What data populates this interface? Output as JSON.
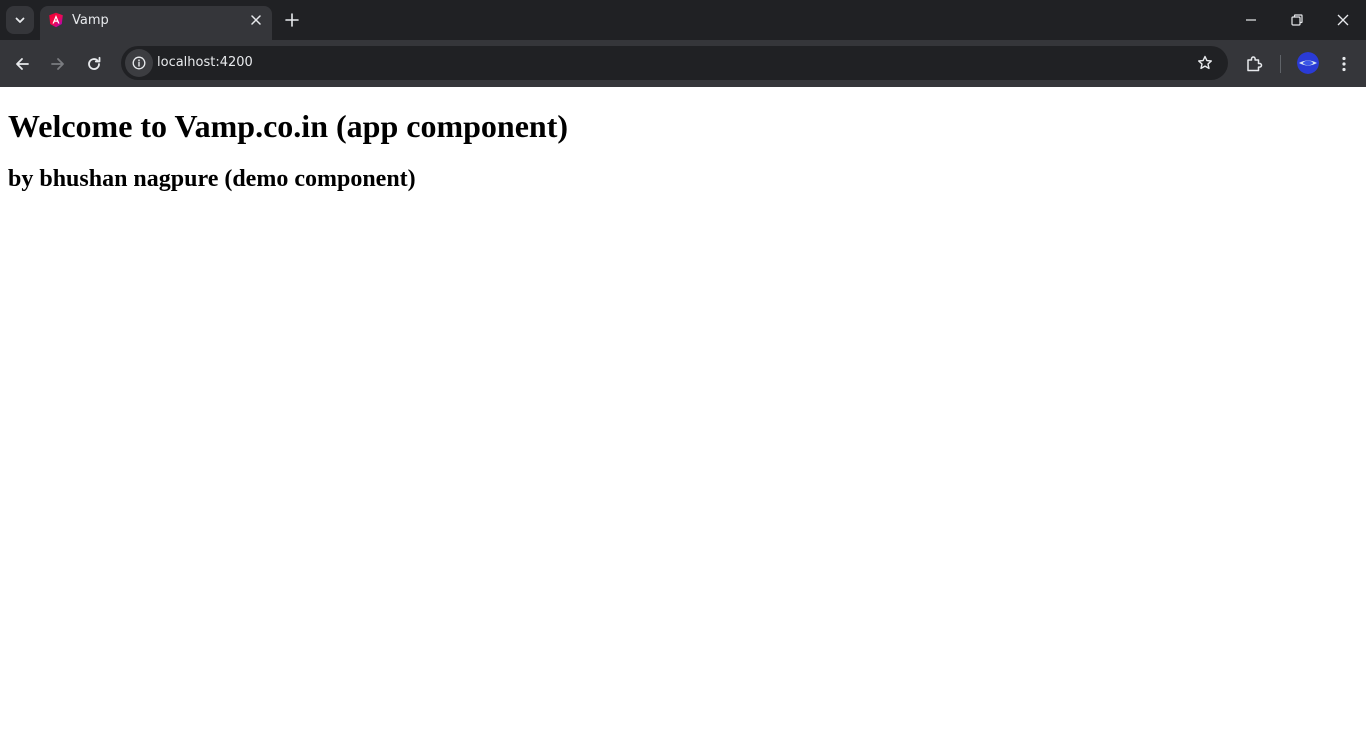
{
  "browser": {
    "tab": {
      "title": "Vamp"
    },
    "address_bar": {
      "url": "localhost:4200"
    },
    "colors": {
      "titlebar": "#202124",
      "toolbar": "#35363a",
      "omnibox": "#202124",
      "icon": "#e8eaed",
      "icon_disabled": "#7a7c80",
      "favicon_accent": "#e0158f"
    },
    "icons": {
      "tab_search": "chevron-down-icon",
      "tab_favicon": "angular-icon",
      "tab_close": "close-icon",
      "new_tab": "plus-icon",
      "minimize": "minimize-icon",
      "restore": "restore-icon",
      "close_window": "close-icon",
      "back": "arrow-left-icon",
      "forward": "arrow-right-icon",
      "reload": "reload-icon",
      "site_info": "info-icon",
      "bookmark": "star-icon",
      "extensions": "puzzle-icon",
      "profile": "avatar",
      "menu": "kebab-menu-icon"
    }
  },
  "page": {
    "heading": "Welcome to Vamp.co.in (app component)",
    "subheading": "by bhushan nagpure (demo component)"
  }
}
